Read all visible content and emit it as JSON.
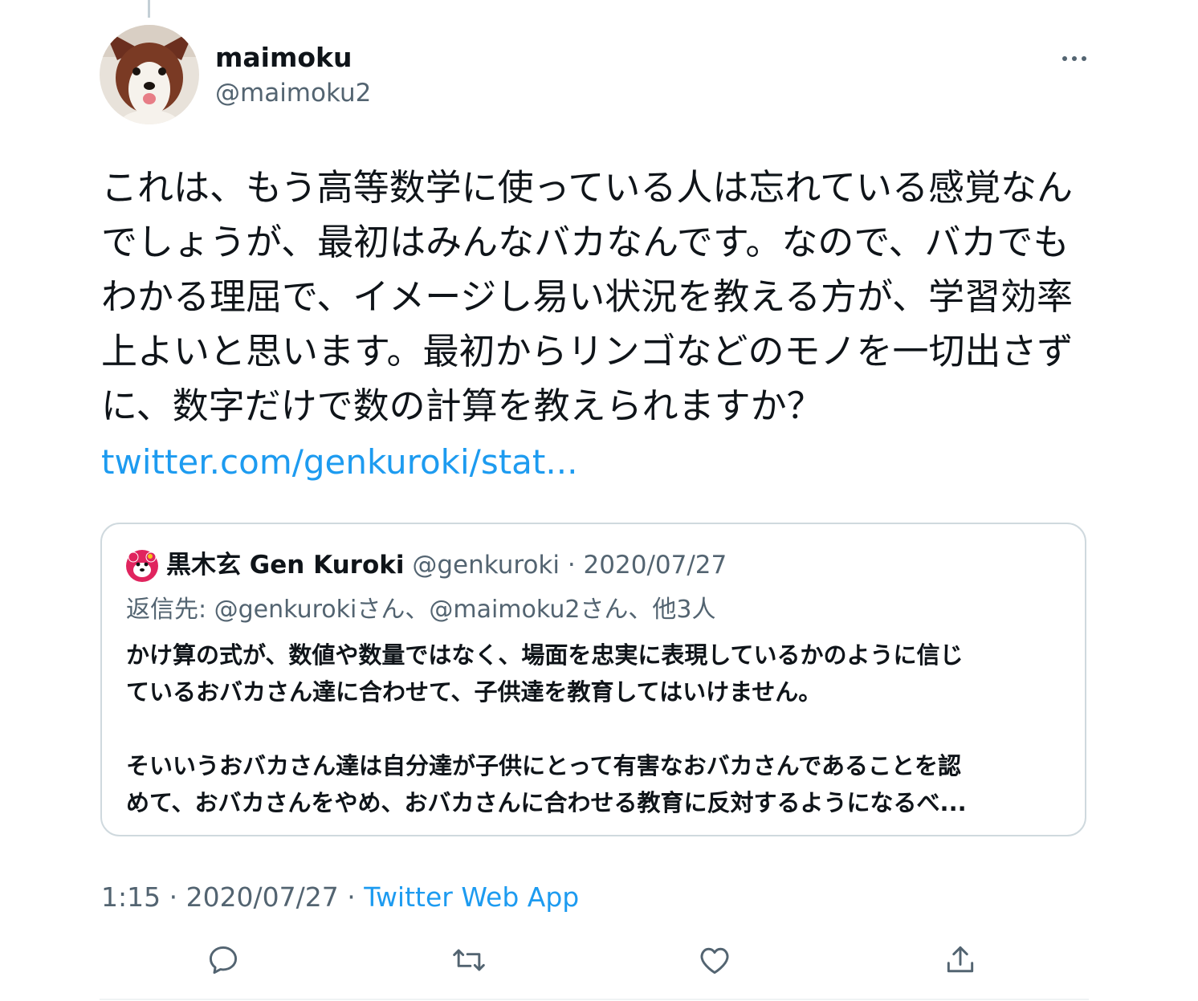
{
  "author": {
    "name": "maimoku",
    "handle": "@maimoku2"
  },
  "tweet": {
    "lines": [
      "これは、もう高等数学に使っている人は忘れている感覚なん",
      "でしょうが、最初はみんなバカなんです。なので、バカでも",
      "わかる理屈で、イメージし易い状況を教える方が、学習効率",
      "上よいと思います。最初からリンゴなどのモノを一切出さず",
      "に、数字だけで数の計算を教えられますか？"
    ],
    "link": "twitter.com/genkuroki/stat..."
  },
  "quote": {
    "name": "黒木玄 Gen Kuroki",
    "meta": " @genkuroki · 2020/07/27",
    "reply": "返信先: @genkurokiさん、@maimoku2さん、他3人",
    "body_lines": [
      "かけ算の式が、数値や数量ではなく、場面を忠実に表現しているかのように信じ",
      "ているおバカさん達に合わせて、子供達を教育してはいけません。",
      "そいいうおバカさん達は自分達が子供にとって有害なおバカさんであることを認",
      "めて、おバカさんをやめ、おバカさんに合わせる教育に反対するようになるべ..."
    ]
  },
  "meta": {
    "time_date": "1:15 · 2020/07/27 · ",
    "source": "Twitter Web App"
  },
  "actions": [
    {
      "icon": "reply-icon"
    },
    {
      "icon": "retweet-icon"
    },
    {
      "icon": "like-icon"
    },
    {
      "icon": "share-icon"
    }
  ],
  "colors": {
    "link": "#1d9bf0",
    "secondary_text": "#536471",
    "border": "#cfd9de",
    "quote_avatar": "#e0245e"
  }
}
